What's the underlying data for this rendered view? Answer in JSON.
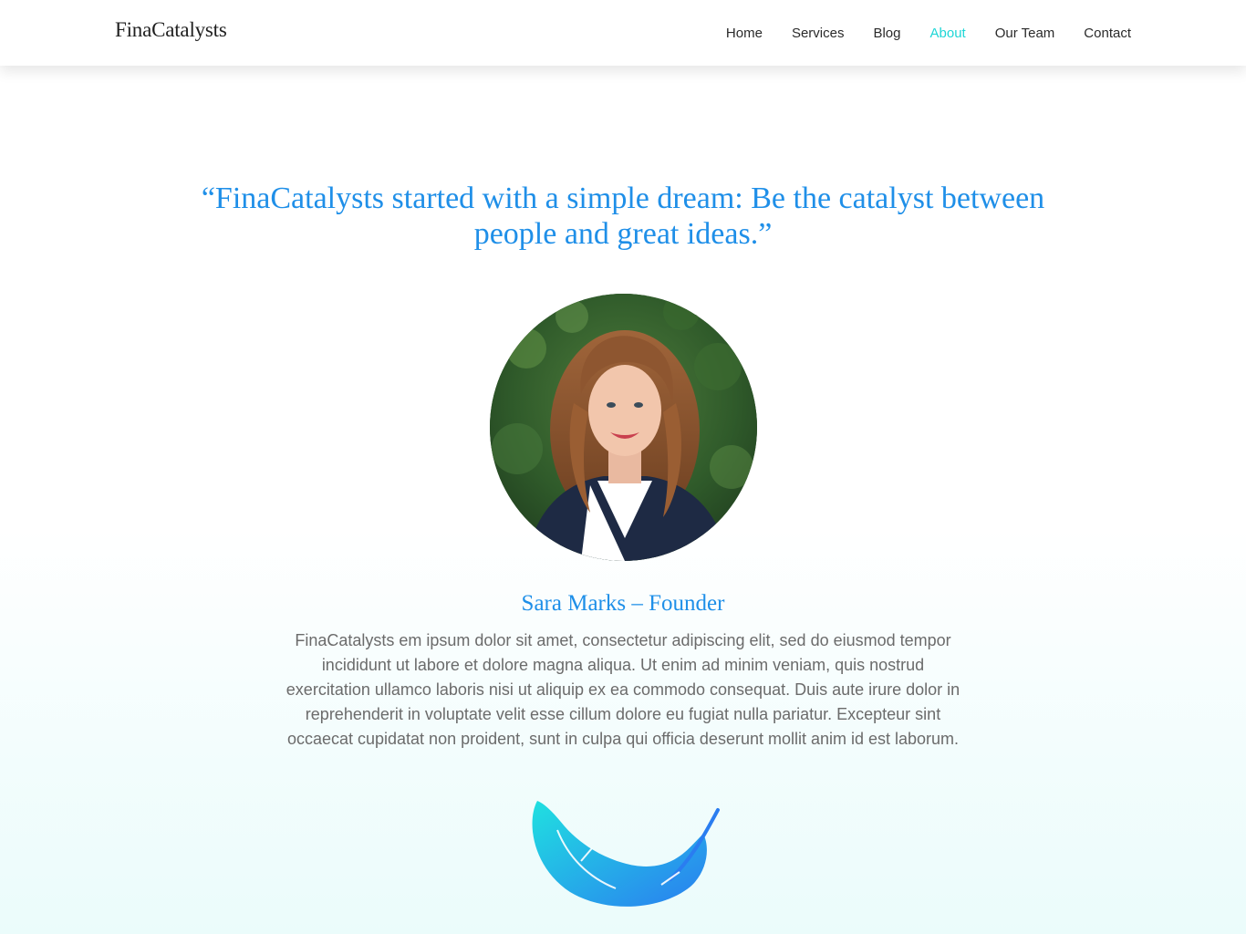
{
  "header": {
    "brand": "FinaCatalysts",
    "nav": [
      {
        "label": "Home",
        "active": false
      },
      {
        "label": "Services",
        "active": false
      },
      {
        "label": "Blog",
        "active": false
      },
      {
        "label": "About",
        "active": true
      },
      {
        "label": "Our Team",
        "active": false
      },
      {
        "label": "Contact",
        "active": false
      }
    ]
  },
  "main": {
    "quote": "“FinaCatalysts started with a simple dream: Be the catalyst between people and great ideas.”",
    "portrait_icon": "founder-photo",
    "name": "Sara Marks – Founder",
    "bio": "FinaCatalysts em ipsum dolor sit amet, consectetur adipiscing elit, sed do eiusmod tempor incididunt ut labore et dolore magna aliqua. Ut enim ad minim veniam, quis nostrud exercitation ullamco laboris nisi ut aliquip ex ea commodo consequat. Duis aute irure dolor in reprehenderit in voluptate velit esse cillum dolore eu fugiat nulla pariatur. Excepteur sint occaecat cupidatat non proident, sunt in culpa qui officia deserunt mollit anim id est laborum.",
    "feather_icon": "feather-icon"
  },
  "colors": {
    "accent_blue": "#1f8fe8",
    "accent_cyan": "#1ed6d6",
    "text_dark": "#2a2a2a",
    "text_muted": "#6b6b6b"
  }
}
